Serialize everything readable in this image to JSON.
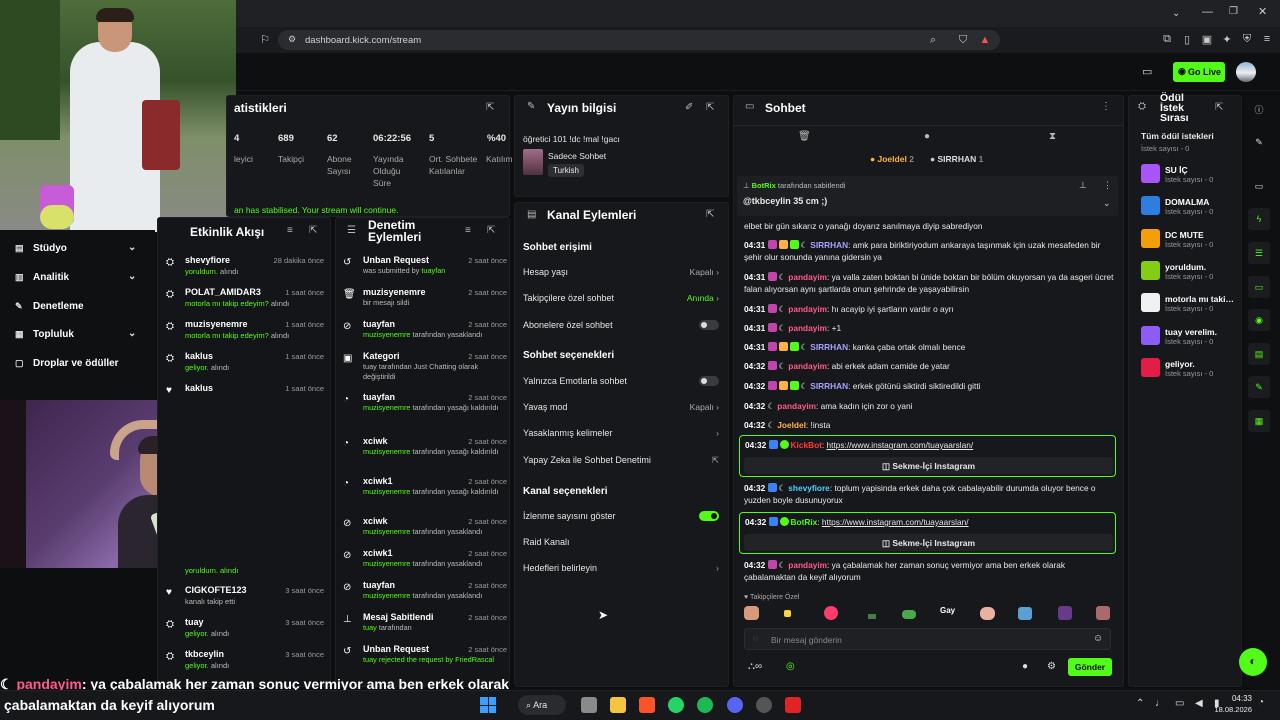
{
  "browser": {
    "url": "dashboard.kick.com/stream",
    "go_live": "Go Live"
  },
  "left_nav": {
    "items": [
      {
        "label": "Stüdyo"
      },
      {
        "label": "Analitik"
      },
      {
        "label": "Denetleme"
      },
      {
        "label": "Topluluk"
      },
      {
        "label": "Droplar ve ödüller"
      }
    ]
  },
  "stats": {
    "title": "atistikleri",
    "items": [
      {
        "value": "4",
        "label": "leyici"
      },
      {
        "value": "689",
        "label": "Takipçi"
      },
      {
        "value": "62",
        "label": "Abone Sayısı"
      },
      {
        "value": "06:22:56",
        "label": "Yayında Olduğu Süre"
      },
      {
        "value": "5",
        "label": "Ort. Sohbete Katılanlar"
      },
      {
        "value": "%40",
        "label": "Katılım"
      }
    ],
    "notice": "an has stabilised. Your stream will continue."
  },
  "stream_info": {
    "title": "Yayın bilgisi",
    "stream_title": "öğretici 101 !dc !mal !gacı",
    "category": "Sadece Sohbet",
    "language": "Turkish"
  },
  "activity": {
    "title": "Etkinlik Akışı",
    "rows": [
      {
        "name": "shevyfiore",
        "desc": "yoruldum.",
        "desc2": "alındı",
        "time": "28 dakika önce"
      },
      {
        "name": "POLAT_AMIDAR3",
        "desc": "motorla mı takip edeyim?",
        "desc2": "alındı",
        "time": "1 saat önce"
      },
      {
        "name": "muzisyenemre",
        "desc": "motorla mı takip edeyim?",
        "desc2": "alındı",
        "time": "1 saat önce"
      },
      {
        "name": "kaklus",
        "desc": "geliyor.",
        "desc2": "alındı",
        "time": "1 saat önce"
      },
      {
        "name": "kaklus",
        "desc": "",
        "desc2": "",
        "time": "1 saat önce"
      },
      {
        "name": "CIGKOFTE123",
        "desc": "",
        "desc2": "kanalı takip etti",
        "time": "3 saat önce"
      },
      {
        "name": "tuay",
        "desc": "geliyor.",
        "desc2": "alındı",
        "time": "3 saat önce"
      },
      {
        "name": "tkbceylin",
        "desc": "geliyor.",
        "desc2": "alındı",
        "time": "3 saat önce"
      }
    ],
    "partial": "yoruldum. alındı"
  },
  "moderation": {
    "title": "Denetim Eylemleri",
    "rows": [
      {
        "name": "Unban Request",
        "desc": "was submitted by",
        "who": "tuayfan",
        "time": "2 saat önce"
      },
      {
        "name": "muzisyenemre",
        "desc": "bir mesajı sildi",
        "who": "",
        "time": "2 saat önce"
      },
      {
        "name": "tuayfan",
        "desc": "muzisyenemre",
        "who": "tarafından yasaklandı",
        "time": "2 saat önce"
      },
      {
        "name": "Kategori",
        "desc": "tuay tarafından Just Chatting olarak değiştirildi",
        "who": "",
        "time": "2 saat önce"
      },
      {
        "name": "tuayfan",
        "desc": "muzisyenemre",
        "who": "tarafından yasağı kaldırıldı",
        "time": "2 saat önce"
      },
      {
        "name": "xciwk",
        "desc": "muzisyenemre",
        "who": "tarafından yasağı kaldırıldı",
        "time": "2 saat önce"
      },
      {
        "name": "xciwk1",
        "desc": "muzisyenemre",
        "who": "tarafından yasağı kaldırıldı",
        "time": "2 saat önce"
      },
      {
        "name": "xciwk",
        "desc": "muzisyenemre",
        "who": "tarafından yasaklandı",
        "time": "2 saat önce"
      },
      {
        "name": "xciwk1",
        "desc": "muzisyenemre",
        "who": "tarafından yasaklandı",
        "time": "2 saat önce"
      },
      {
        "name": "tuayfan",
        "desc": "muzisyenemre",
        "who": "tarafından yasaklandı",
        "time": "2 saat önce"
      },
      {
        "name": "Mesaj Sabitlendi",
        "desc": "tuay",
        "who": "tarafından",
        "time": "2 saat önce"
      },
      {
        "name": "Unban Request",
        "desc": "tuay rejected the request by",
        "who": "FriedRascal",
        "time": "2 saat önce"
      }
    ]
  },
  "channel_actions": {
    "title": "Kanal Eylemleri",
    "chat_access": "Sohbet erişimi",
    "account_age": "Hesap yaşı",
    "account_age_val": "Kapalı",
    "followers_only": "Takipçilere özel sohbet",
    "followers_only_val": "Anında",
    "subs_only": "Abonelere özel sohbet",
    "chat_options": "Sohbet seçenekleri",
    "emotes_only": "Yalnızca Emotlarla sohbet",
    "slow_mode": "Yavaş mod",
    "slow_mode_val": "Kapalı",
    "banned_words": "Yasaklanmış kelimeler",
    "ai_moderation": "Yapay Zeka ile Sohbet Denetimi",
    "channel_options": "Kanal seçenekleri",
    "show_viewers": "İzlenme sayısını göster",
    "raid": "Raid Kanalı",
    "goals": "Hedefleri belirleyin"
  },
  "chat": {
    "title": "Sohbet",
    "top_gifters": [
      {
        "name": "Joeldel",
        "count": "2"
      },
      {
        "name": "SIRRHAN",
        "count": "1"
      }
    ],
    "pinned_by": "BotRix",
    "pinned_suffix": "tarafından sabitlendi",
    "pinned_msg": "@tkbceylin 35 cm ;)",
    "partial_msg": "elbet bir gün sıkarız o yanağı doyarız sanılmaya diyip sabrediyon",
    "messages": [
      {
        "time": "04:31",
        "user": "SIRRHAN",
        "color": "#a5a4ff",
        "text": "amk para biriktiriyodum ankaraya taşınmak için uzak mesafeden bir şehir olur sonunda yanına gidersin ya"
      },
      {
        "time": "04:31",
        "user": "pandayim",
        "color": "#ff5b8a",
        "text": "ya valla zaten boktan bi ünide boktan bir bölüm okuyorsan ya da asgeri ücret falan alıyorsan aynı şartlarda onun şehrinde de yaşayabilirsin"
      },
      {
        "time": "04:31",
        "user": "pandayim",
        "color": "#ff5b8a",
        "text": "hı acayip iyi şartların vardır o ayrı"
      },
      {
        "time": "04:31",
        "user": "pandayim",
        "color": "#ff5b8a",
        "text": "+1"
      },
      {
        "time": "04:31",
        "user": "SIRRHAN",
        "color": "#a5a4ff",
        "text": "kanka çaba ortak olmalı bence"
      },
      {
        "time": "04:32",
        "user": "pandayim",
        "color": "#ff5b8a",
        "text": "abi erkek adam camide de yatar"
      },
      {
        "time": "04:32",
        "user": "SIRRHAN",
        "color": "#a5a4ff",
        "text": "erkek götünü siktirdi siktiredildi gitti"
      },
      {
        "time": "04:32",
        "user": "pandayim",
        "color": "#ff5b8a",
        "text": "ama kadın için zor o yani"
      },
      {
        "time": "04:32",
        "user": "Joeldel",
        "color": "#ffb347",
        "text": "!insta"
      }
    ],
    "bot1": {
      "time": "04:32",
      "user": "KickBot",
      "link": "https://www.instagram.com/tuayaarslan/",
      "button": "Sekme-İçi Instagram"
    },
    "msg_after": {
      "time": "04:32",
      "user": "shevyfiore",
      "text": "toplum yapisinda erkek daha çok cabalayabilir durumda oluyor bence o yuzden boyle dusunuyorux"
    },
    "bot2": {
      "time": "04:32",
      "user": "BotRix",
      "link": "https://www.instagram.com/tuayaarslan/",
      "button": "Sekme-İçi Instagram"
    },
    "last_msg": {
      "time": "04:32",
      "user": "pandayim",
      "text": "ya çabalamak her zaman sonuç vermiyor ama ben erkek olarak çabalamaktan da keyif alıyorum"
    },
    "followers_only_emotes": "Takipçilere Özel",
    "placeholder": "Bir mesaj gönderin",
    "send": "Gönder"
  },
  "rewards": {
    "title": "Ödül İstek Sırası",
    "subtitle": "Tüm ödül istekleri",
    "items": [
      {
        "name": "SU İÇ",
        "count": "İstek sayısı - 0",
        "color": "#a855f7"
      },
      {
        "name": "DOMALMA",
        "count": "İstek sayısı - 0",
        "color": "#2f7de1"
      },
      {
        "name": "DC MUTE",
        "count": "İstek sayısı - 0",
        "color": "#f59e0b"
      },
      {
        "name": "yoruldum.",
        "count": "İstek sayısı - 0",
        "color": "#84cc16"
      },
      {
        "name": "motorla mı takip ed",
        "count": "İstek sayısı - 0",
        "color": "#f1f1f1"
      },
      {
        "name": "tuay verelim.",
        "count": "İstek sayısı - 0",
        "color": "#8b5cf6"
      },
      {
        "name": "geliyor.",
        "count": "İstek sayısı - 0",
        "color": "#e11d48"
      }
    ]
  },
  "overlay": {
    "user": "pandayim",
    "line1": ": ya çabalamak her zaman sonuç vermiyor ama ben erkek olarak",
    "line2": "çabalamaktan da keyif alıyorum"
  },
  "taskbar": {
    "search": "Ara",
    "time": "04:33",
    "date": "18.08.2026"
  }
}
